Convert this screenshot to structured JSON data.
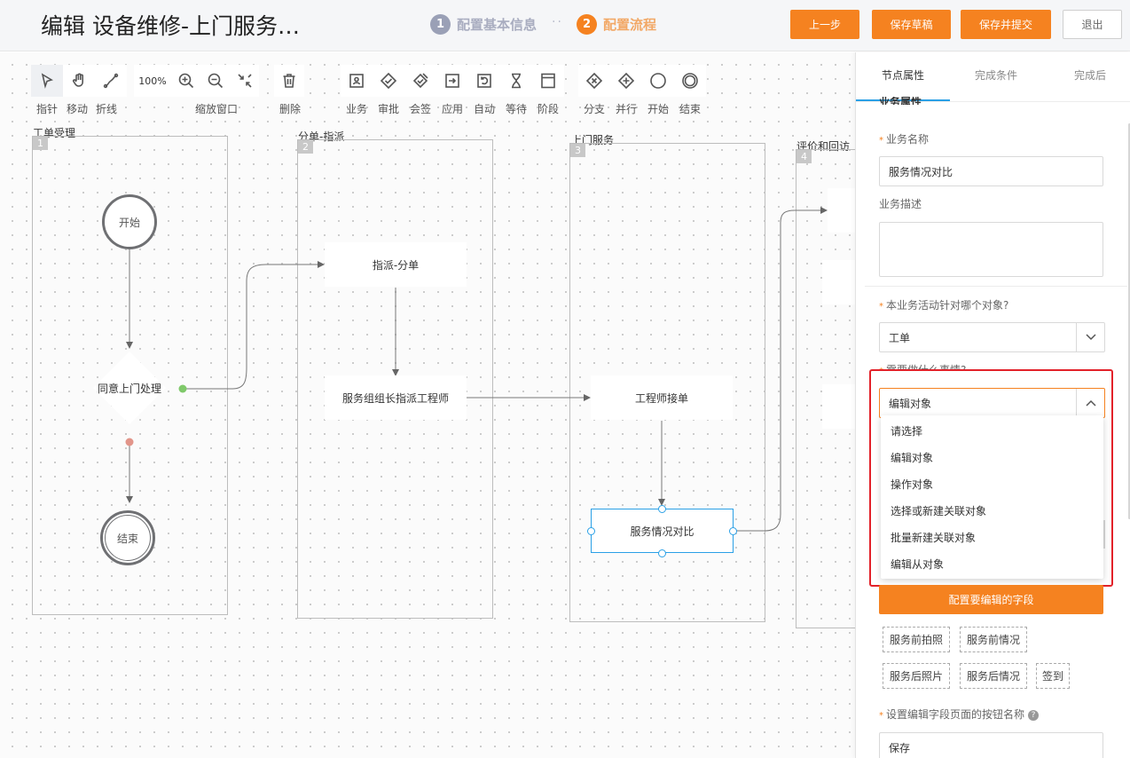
{
  "header": {
    "title": "编辑 设备维修-上门服务…",
    "steps": [
      {
        "num": "1",
        "label": "配置基本信息"
      },
      {
        "num": "2",
        "label": "配置流程"
      }
    ],
    "step_dots": "··",
    "buttons": {
      "prev": "上一步",
      "save_draft": "保存草稿",
      "save_submit": "保存并提交",
      "exit": "退出"
    }
  },
  "toolbar": {
    "zoom": "100%",
    "labels": {
      "pointer": "指针",
      "move": "移动",
      "polyline": "折线",
      "zoom_window": "缩放窗口",
      "delete": "删除",
      "business": "业务",
      "approve": "审批",
      "countersign": "会签",
      "apply": "应用",
      "auto": "自动",
      "wait": "等待",
      "stage": "阶段",
      "branch": "分支",
      "parallel": "并行",
      "start": "开始",
      "end": "结束"
    }
  },
  "lanes": [
    {
      "num": "1",
      "title": "工单受理"
    },
    {
      "num": "2",
      "title": "分单-指派"
    },
    {
      "num": "3",
      "title": "上门服务"
    },
    {
      "num": "4",
      "title": "评价和回访"
    }
  ],
  "nodes": {
    "start": "开始",
    "decision": "同意上门处理",
    "end": "结束",
    "assign": "指派-分单",
    "leader_assign": "服务组组长指派工程师",
    "engineer_accept": "工程师接单",
    "service_compare": "服务情况对比"
  },
  "panel": {
    "tabs": [
      "节点属性",
      "完成条件",
      "完成后"
    ],
    "section_cut": "业务属性",
    "name_label": "业务名称",
    "name_value": "服务情况对比",
    "desc_label": "业务描述",
    "desc_value": "",
    "object_label": "本业务活动针对哪个对象?",
    "object_value": "工单",
    "todo_label": "需要做什么事情?",
    "todo_value": "编辑对象",
    "todo_options": [
      "请选择",
      "编辑对象",
      "操作对象",
      "选择或新建关联对象",
      "批量新建关联对象",
      "编辑从对象"
    ],
    "config_fields_button": "配置要编辑的字段",
    "field_tags": [
      "服务前拍照",
      "服务前情况",
      "服务后照片",
      "服务后情况",
      "签到"
    ],
    "button_name_label": "设置编辑字段页面的按钮名称",
    "button_name_value": "保存"
  }
}
